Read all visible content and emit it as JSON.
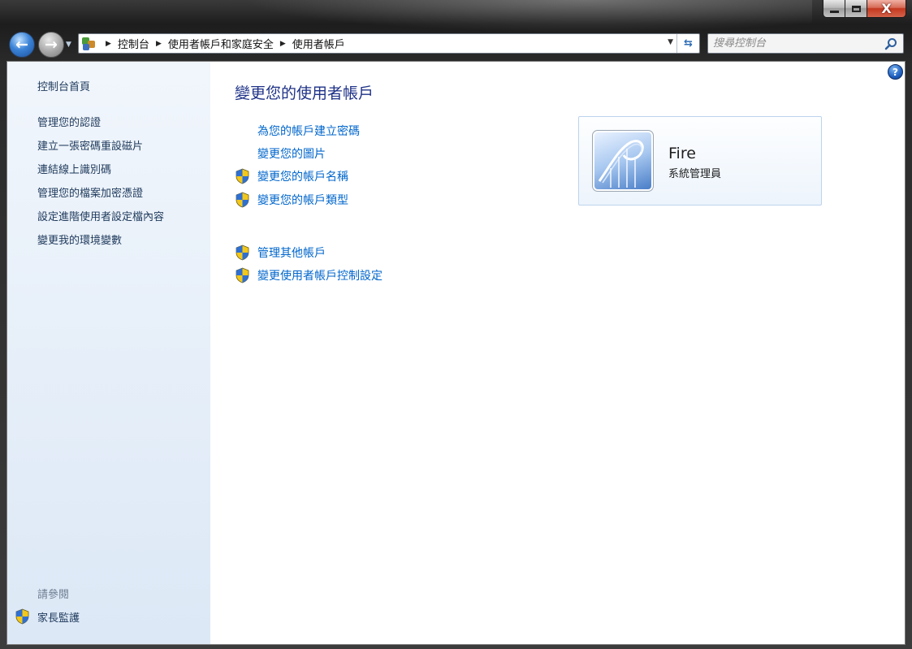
{
  "window": {
    "caption": {
      "minimize": "",
      "maximize": "",
      "close": "X"
    }
  },
  "navigation": {
    "breadcrumb": [
      "控制台",
      "使用者帳戶和家庭安全",
      "使用者帳戶"
    ],
    "search_placeholder": "搜尋控制台"
  },
  "sidebar": {
    "items": [
      {
        "label": "控制台首頁"
      },
      {
        "label": "管理您的認證"
      },
      {
        "label": "建立一張密碼重設磁片"
      },
      {
        "label": "連結線上識別碼"
      },
      {
        "label": "管理您的檔案加密憑證"
      },
      {
        "label": "設定進階使用者設定檔內容"
      },
      {
        "label": "變更我的環境變數"
      }
    ],
    "see_also_heading": "請參閱",
    "see_also_items": [
      {
        "label": "家長監護",
        "icon": "shield-icon"
      }
    ]
  },
  "main": {
    "title": "變更您的使用者帳戶",
    "tasks": [
      {
        "label": "為您的帳戶建立密碼",
        "shield": false
      },
      {
        "label": "變更您的圖片",
        "shield": false
      },
      {
        "label": "變更您的帳戶名稱",
        "shield": true
      },
      {
        "label": "變更您的帳戶類型",
        "shield": true
      },
      {
        "label": "管理其他帳戶",
        "shield": true
      },
      {
        "label": "變更使用者帳戶控制設定",
        "shield": true
      }
    ]
  },
  "user_card": {
    "name": "Fire",
    "role": "系統管理員"
  },
  "colors": {
    "link": "#0066cc",
    "title": "#1e3287",
    "sidebar_link": "#1e395b"
  }
}
